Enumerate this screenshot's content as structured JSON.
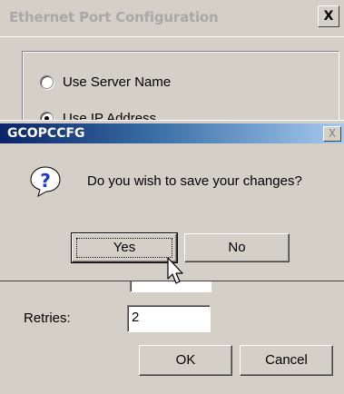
{
  "background_window": {
    "title": "Ethernet Port Configuration",
    "close_glyph": "X",
    "radio_options": [
      {
        "label": "Use Server Name",
        "selected": false
      },
      {
        "label": "Use IP Address",
        "selected": true
      }
    ],
    "retries_label": "Retries:",
    "retries_value": "2",
    "ok_label": "OK",
    "cancel_label": "Cancel"
  },
  "dialog": {
    "title": "GCOPCCFG",
    "close_glyph": "X",
    "icon": "question-icon",
    "message": "Do you wish to save your changes?",
    "yes_label": "Yes",
    "no_label": "No"
  },
  "colors": {
    "face": "#d4d0c8",
    "title_active_start": "#0a246a",
    "title_active_end": "#a6caf0",
    "icon_blue": "#1a3ad8"
  }
}
